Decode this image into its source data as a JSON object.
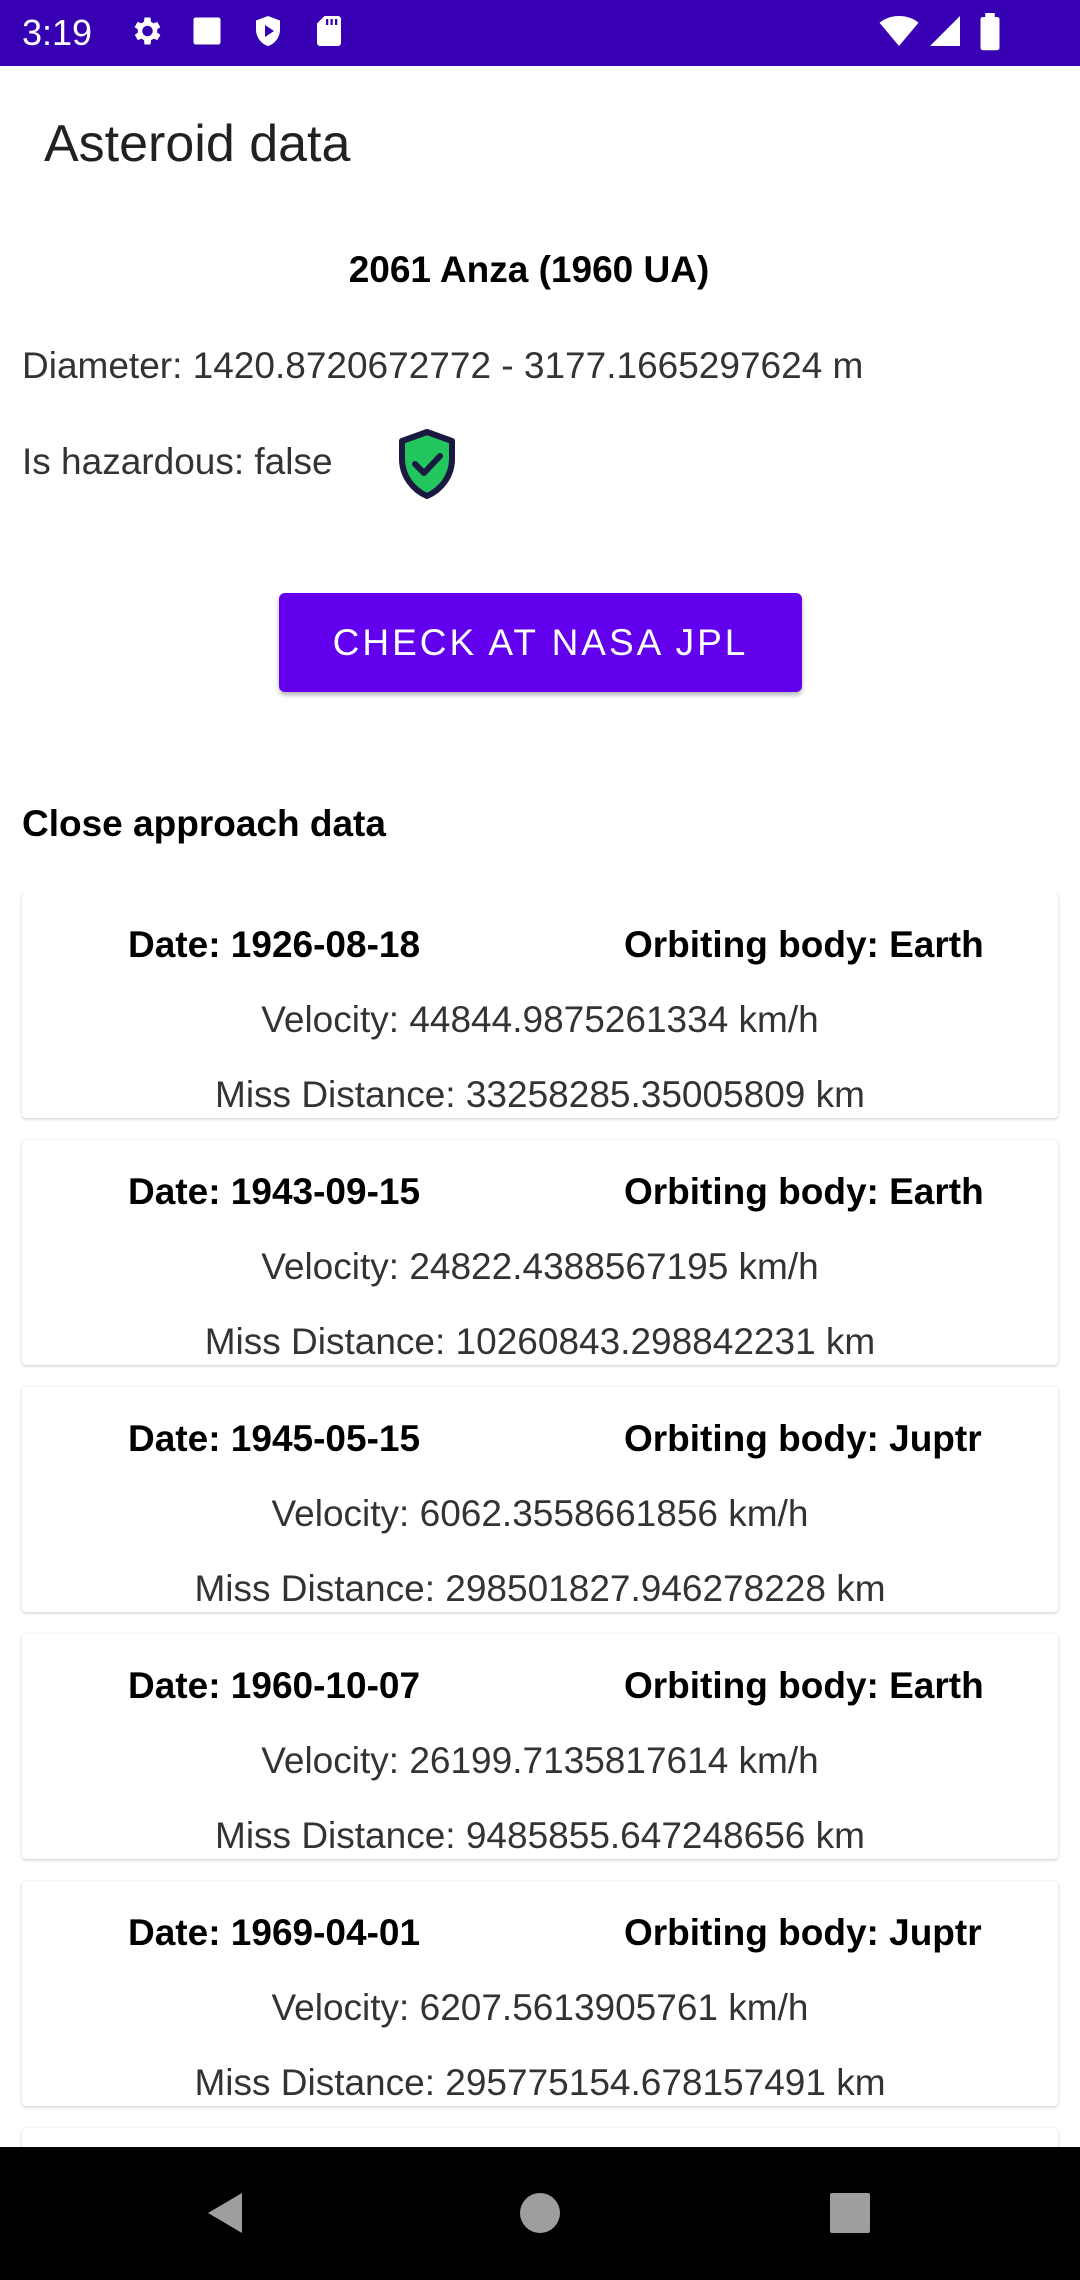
{
  "status_bar": {
    "time": "3:19",
    "icons_left": [
      "gear-icon",
      "square-icon",
      "play-shield-icon",
      "sd-card-icon"
    ],
    "icons_right": [
      "wifi-icon",
      "signal-icon",
      "battery-icon"
    ]
  },
  "app_bar": {
    "title": "Asteroid data"
  },
  "asteroid": {
    "name": "2061 Anza (1960 UA)",
    "diameter": "Diameter: 1420.8720672772 - 3177.1665297624 m",
    "hazardous": "Is hazardous: false",
    "hazard_icon": "shield-check-icon"
  },
  "button": {
    "label": "CHECK AT NASA JPL"
  },
  "section": {
    "close_approach_title": "Close approach data"
  },
  "approaches": [
    {
      "date": "Date: 1926-08-18",
      "body": "Orbiting body: Earth",
      "velocity": "Velocity: 44844.9875261334 km/h",
      "miss": "Miss Distance: 33258285.35005809 km"
    },
    {
      "date": "Date: 1943-09-15",
      "body": "Orbiting body: Earth",
      "velocity": "Velocity: 24822.4388567195 km/h",
      "miss": "Miss Distance: 10260843.298842231 km"
    },
    {
      "date": "Date: 1945-05-15",
      "body": "Orbiting body: Juptr",
      "velocity": "Velocity: 6062.3558661856 km/h",
      "miss": "Miss Distance: 298501827.946278228 km"
    },
    {
      "date": "Date: 1960-10-07",
      "body": "Orbiting body: Earth",
      "velocity": "Velocity: 26199.7135817614 km/h",
      "miss": "Miss Distance: 9485855.647248656 km"
    },
    {
      "date": "Date: 1969-04-01",
      "body": "Orbiting body: Juptr",
      "velocity": "Velocity: 6207.5613905761 km/h",
      "miss": "Miss Distance: 295775154.678157491 km"
    },
    {
      "date": "",
      "body": "",
      "velocity": "",
      "miss": ""
    }
  ],
  "nav_bar": {
    "icons": [
      "back-icon",
      "home-icon",
      "recents-icon"
    ]
  },
  "colors": {
    "status_bar": "#3700b3",
    "primary": "#6200ee",
    "shield_fill": "#23c55e",
    "shield_outline": "#1a1a40"
  }
}
